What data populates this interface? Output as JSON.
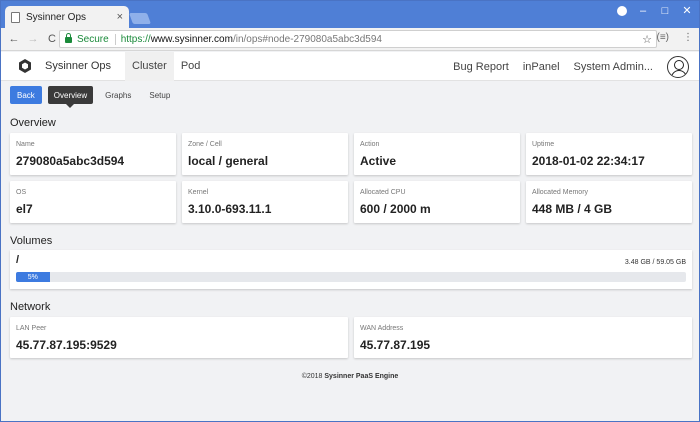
{
  "browser": {
    "tab_title": "Sysinner Ops",
    "tab_close": "×",
    "secure_label": "Secure",
    "url_scheme": "https://",
    "url_host": "www.sysinner.com",
    "url_path": "/in/ops#node-279080a5abc3d594",
    "nav_back": "←",
    "nav_forward": "→",
    "nav_reload": "C",
    "star": "☆",
    "ext_icon": "(≡)",
    "menu_icon": "⋮",
    "win_min": "–",
    "win_max": "□",
    "win_close": "✕"
  },
  "appnav": {
    "brand": "Sysinner Ops",
    "links": [
      "Cluster",
      "Pod"
    ],
    "right_links": [
      "Bug Report",
      "inPanel",
      "System Admin..."
    ]
  },
  "subtabs": {
    "back": "Back",
    "items": [
      "Overview",
      "Graphs",
      "Setup"
    ]
  },
  "overview": {
    "title": "Overview",
    "cards": [
      {
        "label": "Name",
        "value": "279080a5abc3d594"
      },
      {
        "label": "Zone / Cell",
        "value": "local / general"
      },
      {
        "label": "Action",
        "value": "Active"
      },
      {
        "label": "Uptime",
        "value": "2018-01-02 22:34:17"
      },
      {
        "label": "OS",
        "value": "el7"
      },
      {
        "label": "Kernel",
        "value": "3.10.0-693.11.1"
      },
      {
        "label": "Allocated CPU",
        "value": "600 / 2000 m"
      },
      {
        "label": "Allocated Memory",
        "value": "448 MB / 4 GB"
      }
    ]
  },
  "volumes": {
    "title": "Volumes",
    "items": [
      {
        "mount": "/",
        "size": "3.48 GB / 59.05 GB",
        "percent_label": "5%",
        "percent": 5
      }
    ]
  },
  "network": {
    "title": "Network",
    "cards": [
      {
        "label": "LAN Peer",
        "value": "45.77.87.195:9529"
      },
      {
        "label": "WAN Address",
        "value": "45.77.87.195"
      }
    ]
  },
  "footer": {
    "copyright": "©2018",
    "product": "Sysinner PaaS Engine"
  }
}
